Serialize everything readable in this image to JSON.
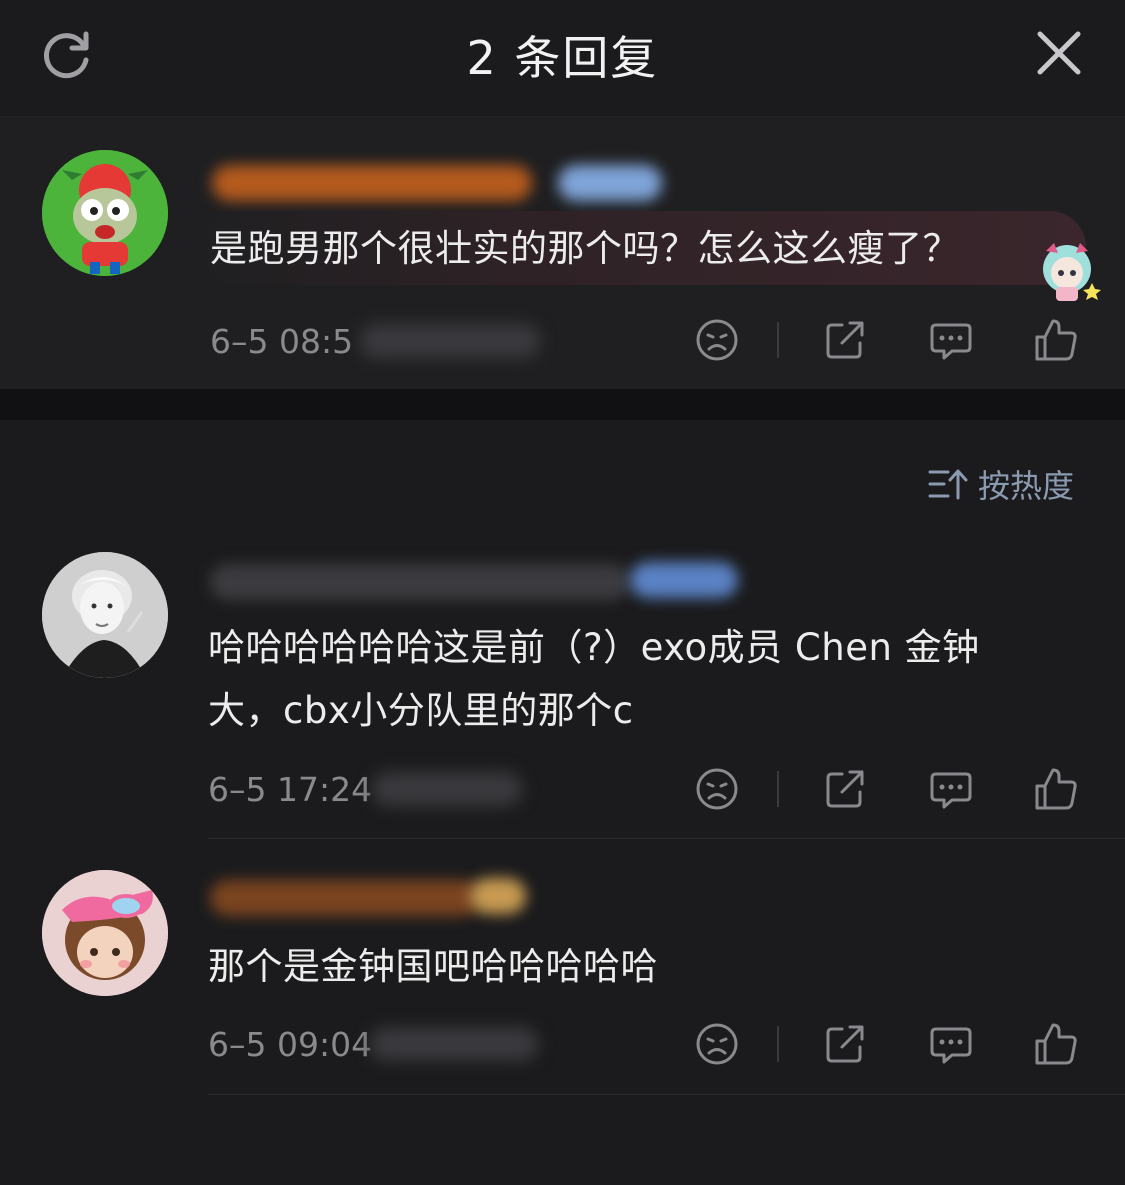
{
  "header": {
    "title": "2 条回复",
    "refresh_icon": "refresh-icon",
    "close_icon": "close-icon"
  },
  "root_comment": {
    "text": "是跑男那个很壮实的那个吗？怎么这么瘦了？",
    "time": "6–5 08:5",
    "actions": [
      "dislike-icon",
      "share-icon",
      "comment-icon",
      "like-icon"
    ]
  },
  "sort": {
    "label": "按热度",
    "icon": "sort-icon"
  },
  "replies": [
    {
      "text_line1": "哈哈哈哈哈哈这是前（?）exo成员 Chen 金钟",
      "text_line2": "大，cbx小分队里的那个c",
      "time": "6–5 17:24"
    },
    {
      "text_line1": "那个是金钟国吧哈哈哈哈哈",
      "time": "6–5 09:04"
    }
  ],
  "colors": {
    "background": "#1b1b1d",
    "text": "#ececec",
    "muted": "#8a8a8e",
    "sort": "#8a9ab0"
  }
}
